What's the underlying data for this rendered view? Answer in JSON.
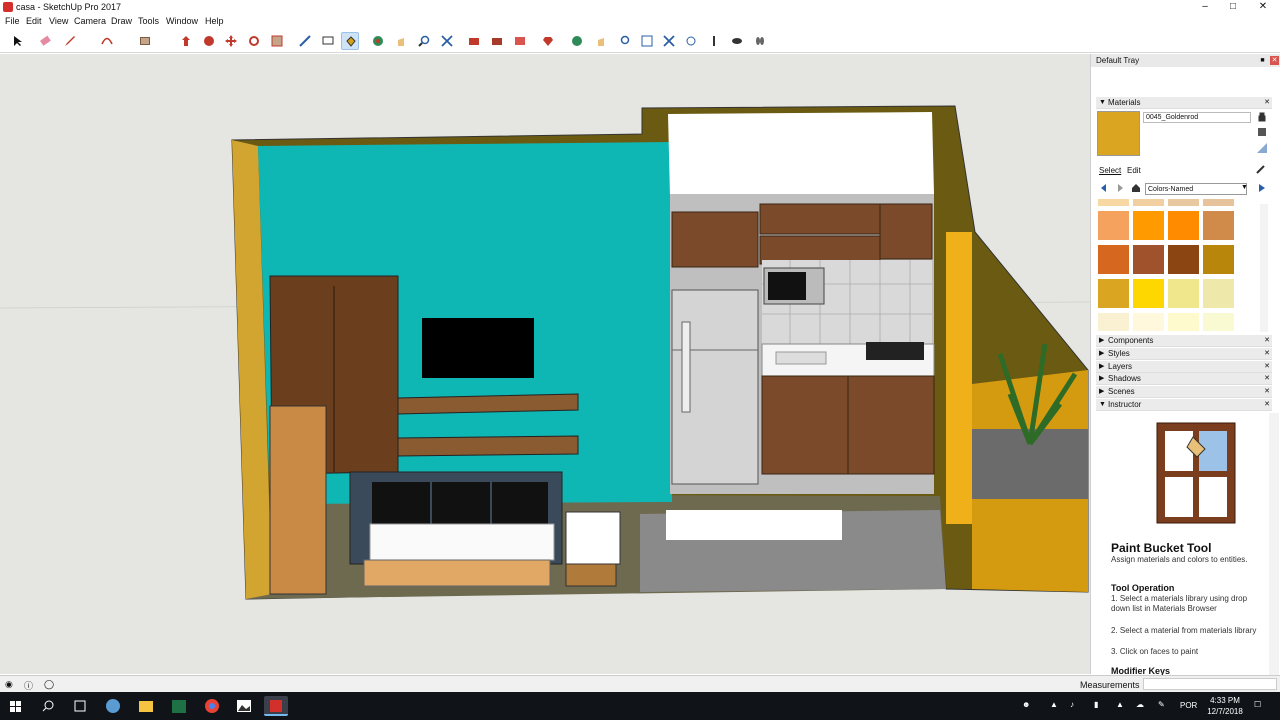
{
  "window": {
    "title": "casa - SketchUp Pro 2017"
  },
  "menu": [
    "File",
    "Edit",
    "View",
    "Camera",
    "Draw",
    "Tools",
    "Window",
    "Help"
  ],
  "tray": {
    "title": "Default Tray",
    "materials": {
      "header": "Materials",
      "material_name": "0045_Goldenrod",
      "active_color": "#DAA520",
      "tab_select": "Select",
      "tab_edit": "Edit",
      "library": "Colors-Named",
      "swatches": [
        "#f7d7a2",
        "#f2cfa0",
        "#e8c8a0",
        "#e6c39b",
        "#f5a25e",
        "#ff9a00",
        "#ff8c00",
        "#d08a4a",
        "#d6671e",
        "#a0522d",
        "#8b4513",
        "#b8860b",
        "#daa520",
        "#ffd700",
        "#f0e68c",
        "#eee8aa",
        "#faf0d2",
        "#fff8dc",
        "#fffacd",
        "#fafad2"
      ]
    },
    "panels": [
      "Components",
      "Styles",
      "Layers",
      "Shadows",
      "Scenes",
      "Instructor"
    ],
    "instructor": {
      "title": "Paint Bucket Tool",
      "desc": "Assign materials and colors to entities.",
      "op_title": "Tool Operation",
      "steps": [
        "1. Select a materials library using drop down list in Materials Browser",
        "2. Select a material from materials library",
        "3. Click on faces to paint"
      ],
      "modifier": "Modifier Keys"
    }
  },
  "status": {
    "measurements_label": "Measurements"
  },
  "taskbar": {
    "lang": "POR",
    "time": "4:33 PM",
    "date": "12/7/2018"
  },
  "icons": [
    "select-icon",
    "eraser-icon",
    "pencil-icon",
    "arc-icon",
    "rectangle-icon",
    "pushpull-icon",
    "move-icon",
    "rotate-icon",
    "scale-icon",
    "offset-icon",
    "tape-icon",
    "text-icon",
    "paint-bucket-icon",
    "orbit-icon",
    "pan-icon",
    "zoom-icon",
    "zoom-extents-icon",
    "warehouse-icon"
  ]
}
